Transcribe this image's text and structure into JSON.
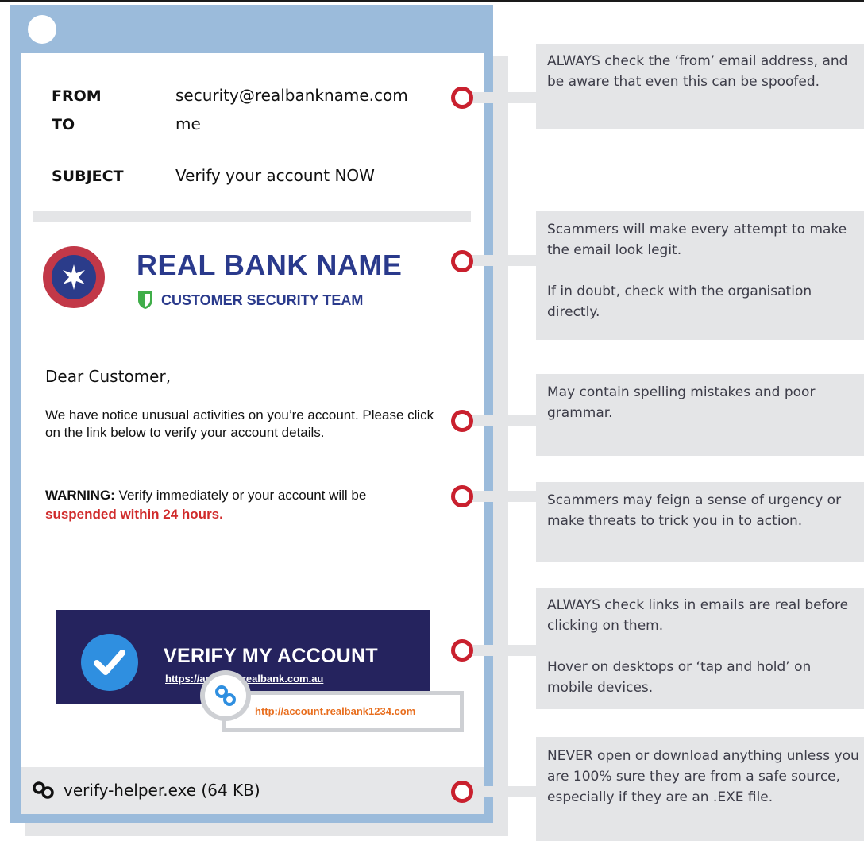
{
  "email": {
    "from_label": "FROM",
    "from_value": "security@realbankname.com",
    "to_label": "TO",
    "to_value": "me",
    "subject_label": "SUBJECT",
    "subject_value": "Verify your account NOW",
    "bank_name": "REAL BANK NAME",
    "team_name": "CUSTOMER SECURITY TEAM",
    "greeting": "Dear Customer,",
    "body": "We have notice unusual activities on you’re account. Please click on the link below to verify your account details.",
    "warning_label": "WARNING:",
    "warning_text": " Verify immediately or your account will be",
    "warning_red": "suspended within 24 hours.",
    "button_label": "VERIFY MY ACCOUNT",
    "button_url": "https://account.realbank.com.au",
    "hover_url": "http://account.realbank1234.com",
    "attachment": "verify-helper.exe (64 KB)"
  },
  "tips": [
    "ALWAYS check the ‘from’ email address, and be aware that even this can be spoofed.",
    "Scammers will make every attempt to make the email look legit.\n\nIf in doubt, check with the organisation directly.",
    "May contain spelling mistakes and poor grammar.",
    "Scammers may feign a sense of urgency or make threats to trick you in to action.",
    "ALWAYS check links in emails are real before clicking on them.\n\nHover on desktops or ‘tap and hold’ on mobile devices.",
    "NEVER open or download anything unless you are 100% sure they are from a safe source, especially if they are an .EXE file."
  ],
  "colors": {
    "frame": "#9bbbdb",
    "marker": "#c9202e",
    "bank_blue": "#2a3a8c",
    "button_bg": "#25235e",
    "warning_red": "#d02b2b",
    "fake_link": "#e86e1e",
    "tip_bg": "#e4e5e7"
  },
  "icons": [
    "star-logo-icon",
    "shield-icon",
    "checkmark-icon",
    "link-icon"
  ]
}
